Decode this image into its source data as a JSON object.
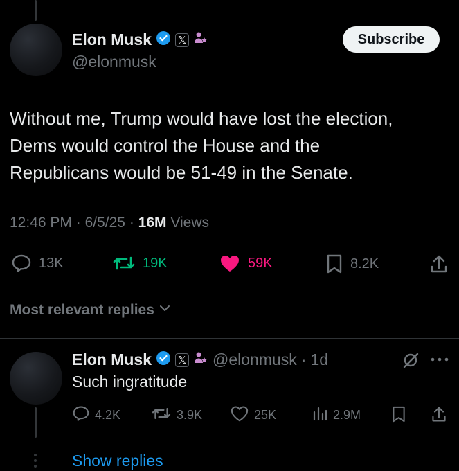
{
  "post": {
    "author_name": "Elon Musk",
    "author_handle": "@elonmusk",
    "subscribe_label": "Subscribe",
    "text_lines": [
      "Without me, Trump would have lost the election,",
      "Dems would control the House and the",
      "Republicans would be 51-49 in the Senate."
    ],
    "time": "12:46 PM",
    "date": "6/5/25",
    "views_count": "16M",
    "views_label": "Views",
    "stats": {
      "replies": "13K",
      "reposts": "19K",
      "likes": "59K",
      "bookmarks": "8.2K"
    }
  },
  "sort": {
    "label": "Most relevant replies"
  },
  "reply": {
    "author_name": "Elon Musk",
    "author_handle": "@elonmusk",
    "age": "1d",
    "text": "Such ingratitude",
    "stats": {
      "replies": "4.2K",
      "reposts": "3.9K",
      "likes": "25K",
      "views": "2.9M"
    },
    "show_replies_label": "Show replies"
  },
  "colors": {
    "background": "#000000",
    "verified": "#1d9bf0",
    "repost": "#00ba7c",
    "like": "#f91880",
    "muted": "#71767b",
    "affiliate": "#c98ccf"
  },
  "icons": [
    "verified-badge-icon",
    "x-badge-icon",
    "affiliate-icon",
    "reply-icon",
    "repost-icon",
    "like-icon",
    "bookmark-icon",
    "share-icon",
    "views-icon",
    "grok-icon",
    "more-icon",
    "chevron-down-icon"
  ]
}
